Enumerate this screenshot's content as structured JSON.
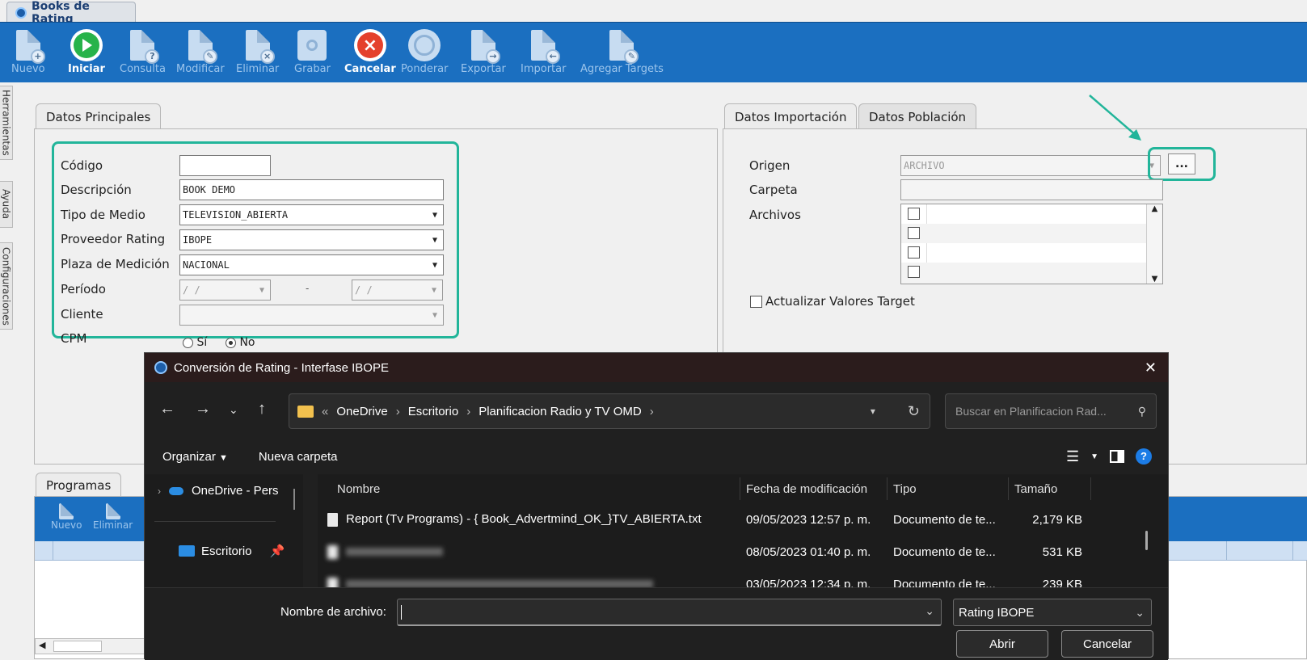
{
  "app": {
    "tab_title": "Books de Rating"
  },
  "toolbar": {
    "buttons": [
      {
        "label": "Nuevo",
        "icon": "new-document-icon"
      },
      {
        "label": "Iniciar",
        "icon": "play-icon"
      },
      {
        "label": "Consulta",
        "icon": "query-document-icon"
      },
      {
        "label": "Modificar",
        "icon": "edit-document-icon"
      },
      {
        "label": "Eliminar",
        "icon": "delete-document-icon"
      },
      {
        "label": "Grabar",
        "icon": "save-icon"
      },
      {
        "label": "Cancelar",
        "icon": "cancel-icon"
      },
      {
        "label": "Ponderar",
        "icon": "weight-icon"
      },
      {
        "label": "Exportar",
        "icon": "export-icon"
      },
      {
        "label": "Importar",
        "icon": "import-icon"
      },
      {
        "label": "Agregar Targets",
        "icon": "add-targets-icon"
      }
    ]
  },
  "side_tabs": [
    "Herramientas",
    "Ayuda",
    "Configuraciones"
  ],
  "datos_principales": {
    "tab": "Datos Principales",
    "codigo_label": "Código",
    "codigo_value": "",
    "descripcion_label": "Descripción",
    "descripcion_value": "BOOK DEMO",
    "tipo_medio_label": "Tipo de Medio",
    "tipo_medio_value": "TELEVISION_ABIERTA",
    "proveedor_label": "Proveedor Rating",
    "proveedor_value": "IBOPE",
    "plaza_label": "Plaza de Medición",
    "plaza_value": "NACIONAL",
    "periodo_label": "Período",
    "periodo_from": "/ /",
    "periodo_sep": "-",
    "periodo_to": "/ /",
    "cliente_label": "Cliente",
    "cliente_value": "",
    "cpm_label": "CPM",
    "cpm_si": "Sí",
    "cpm_no": "No"
  },
  "datos_importacion": {
    "tab": "Datos Importación",
    "tab2": "Datos Población",
    "origen_label": "Origen",
    "origen_value": "ARCHIVO",
    "browse_label": "...",
    "carpeta_label": "Carpeta",
    "archivos_label": "Archivos",
    "actualizar_label": "Actualizar Valores Target"
  },
  "programas": {
    "tab": "Programas",
    "buttons": [
      "Nuevo",
      "Eliminar"
    ]
  },
  "dialog": {
    "title": "Conversión de Rating - Interfase IBOPE",
    "close": "✕",
    "breadcrumb": [
      "OneDrive",
      "Escritorio",
      "Planificacion Radio y TV OMD"
    ],
    "search_placeholder": "Buscar en Planificacion Rad...",
    "organizar": "Organizar",
    "nueva_carpeta": "Nueva carpeta",
    "nav_items": [
      "OneDrive - Pers",
      "Escritorio"
    ],
    "columns": [
      "Nombre",
      "Fecha de modificación",
      "Tipo",
      "Tamaño"
    ],
    "files": [
      {
        "name": "Report (Tv Programs) - { Book_Advertmind_OK_}TV_ABIERTA.txt",
        "date": "09/05/2023 12:57 p. m.",
        "type": "Documento de te...",
        "size": "2,179 KB"
      },
      {
        "name": "",
        "date": "08/05/2023 01:40 p. m.",
        "type": "Documento de te...",
        "size": "531 KB"
      },
      {
        "name": "",
        "date": "03/05/2023 12:34 p. m.",
        "type": "Documento de te...",
        "size": "239 KB"
      }
    ],
    "filename_label": "Nombre de archivo:",
    "filename_value": "",
    "filetype_value": "Rating IBOPE",
    "open_label": "Abrir",
    "cancel_label": "Cancelar"
  }
}
